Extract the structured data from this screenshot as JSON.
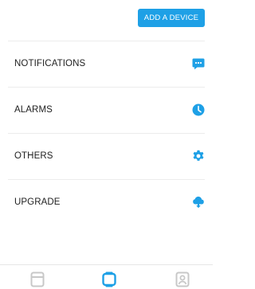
{
  "header": {
    "add_device_label": "ADD A DEVICE"
  },
  "menu": {
    "items": [
      {
        "label": "NOTIFICATIONS",
        "icon": "chat-bubble-icon"
      },
      {
        "label": "ALARMS",
        "icon": "clock-icon"
      },
      {
        "label": "OTHERS",
        "icon": "gear-icon"
      },
      {
        "label": "UPGRADE",
        "icon": "cloud-download-icon"
      }
    ]
  },
  "tabbar": {
    "tabs": [
      {
        "icon": "document-icon",
        "active": false
      },
      {
        "icon": "watch-icon",
        "active": true
      },
      {
        "icon": "profile-icon",
        "active": false
      }
    ]
  },
  "colors": {
    "accent": "#1ea0e6",
    "inactive_icon": "#c8c8c8",
    "text": "#222222"
  }
}
